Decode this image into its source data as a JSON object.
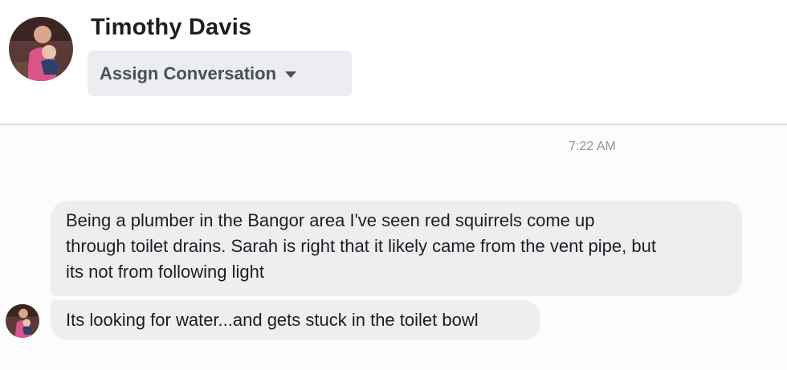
{
  "header": {
    "contact_name": "Timothy Davis",
    "assign_button_label": "Assign Conversation",
    "assign_button_icon": "caret-down-icon"
  },
  "thread": {
    "timestamp": "7:22 AM",
    "messages": [
      {
        "lines": [
          "Being a plumber in the Bangor area I've seen red squirrels come up",
          "through toilet drains. Sarah is right that it likely came from the vent pipe, but",
          "its not from following light"
        ]
      },
      {
        "lines": [
          "Its looking for water...and gets stuck in the toilet bowl"
        ]
      }
    ]
  },
  "colors": {
    "bubble_background": "#eeeef1",
    "button_background": "#ebedf0",
    "divider": "#dadde1",
    "timestamp_text": "#8d949e"
  }
}
